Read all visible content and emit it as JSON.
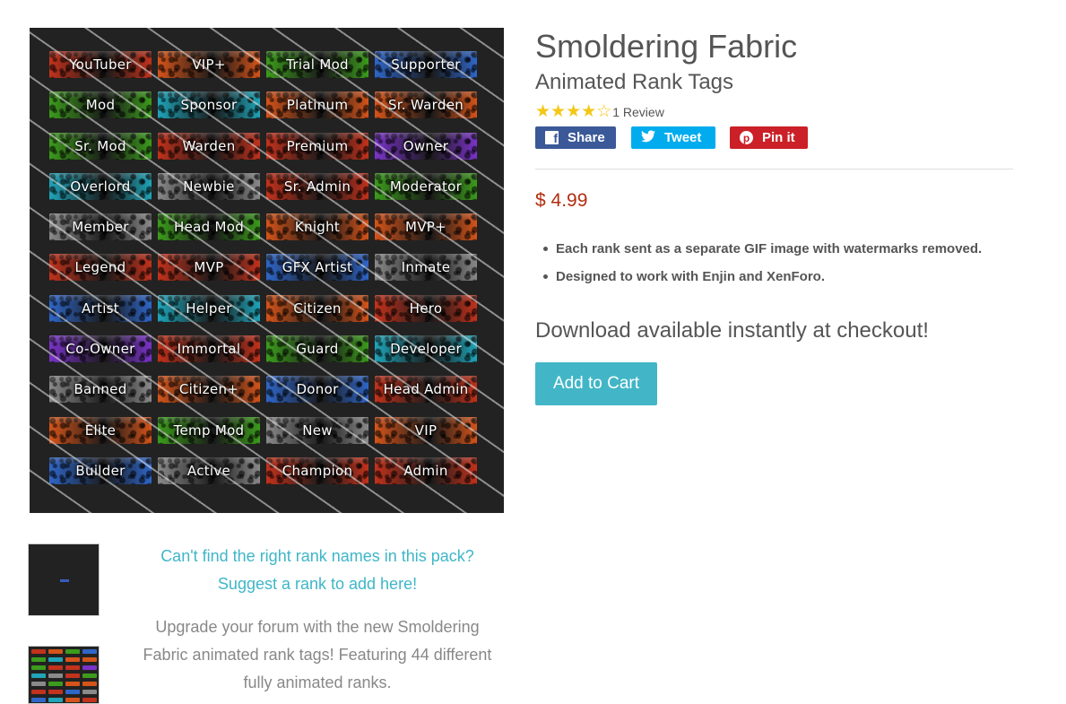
{
  "product": {
    "title": "Smoldering Fabric",
    "subtitle": "Animated Rank Tags",
    "rating": 4,
    "rating_max": 5,
    "review_count": "1 Review",
    "price": "$ 4.99",
    "features": [
      "Each rank sent as a separate GIF image with watermarks removed.",
      "Designed to work with Enjin and XenForo."
    ],
    "download_note": "Download available instantly at checkout!",
    "add_to_cart_label": "Add to Cart"
  },
  "social": {
    "share_label": "Share",
    "tweet_label": "Tweet",
    "pin_label": "Pin it",
    "share_icon": "facebook-icon",
    "tweet_icon": "twitter-icon",
    "pin_icon": "pinterest-icon",
    "share_color": "#3b5998",
    "tweet_color": "#00aced",
    "pin_color": "#cb2027"
  },
  "colors": {
    "accent": "#42b6c7",
    "price": "#b32d10",
    "star": "#f3c716"
  },
  "description": {
    "suggest_line1": "Can't find the right rank names in this pack?",
    "suggest_line2": "Suggest a rank to add here!",
    "body": "Upgrade your forum with the new Smoldering Fabric animated rank tags! Featuring 44 different fully animated ranks."
  },
  "rank_tags": [
    {
      "label": "YouTuber",
      "color": "#c2321c"
    },
    {
      "label": "VIP+",
      "color": "#d4541a"
    },
    {
      "label": "Trial Mod",
      "color": "#3c9b1c"
    },
    {
      "label": "Supporter",
      "color": "#2f66c8"
    },
    {
      "label": "Mod",
      "color": "#3c9b1c"
    },
    {
      "label": "Sponsor",
      "color": "#1fa4b8"
    },
    {
      "label": "Platinum",
      "color": "#d4541a"
    },
    {
      "label": "Sr. Warden",
      "color": "#d4541a"
    },
    {
      "label": "Sr. Mod",
      "color": "#3c9b1c"
    },
    {
      "label": "Warden",
      "color": "#c2321c"
    },
    {
      "label": "Premium",
      "color": "#c2321c"
    },
    {
      "label": "Owner",
      "color": "#7a33c9"
    },
    {
      "label": "Overlord",
      "color": "#1fa4b8"
    },
    {
      "label": "Newbie",
      "color": "#8a8a8a"
    },
    {
      "label": "Sr. Admin",
      "color": "#c2321c"
    },
    {
      "label": "Moderator",
      "color": "#3c9b1c"
    },
    {
      "label": "Member",
      "color": "#8a8a8a"
    },
    {
      "label": "Head Mod",
      "color": "#3c9b1c"
    },
    {
      "label": "Knight",
      "color": "#d4541a"
    },
    {
      "label": "MVP+",
      "color": "#d4541a"
    },
    {
      "label": "Legend",
      "color": "#c2321c"
    },
    {
      "label": "MVP",
      "color": "#c2321c"
    },
    {
      "label": "GFX Artist",
      "color": "#2f66c8"
    },
    {
      "label": "Inmate",
      "color": "#8a8a8a"
    },
    {
      "label": "Artist",
      "color": "#2f66c8"
    },
    {
      "label": "Helper",
      "color": "#1fa4b8"
    },
    {
      "label": "Citizen",
      "color": "#d4541a"
    },
    {
      "label": "Hero",
      "color": "#c2321c"
    },
    {
      "label": "Co-Owner",
      "color": "#7a33c9"
    },
    {
      "label": "Immortal",
      "color": "#c2321c"
    },
    {
      "label": "Guard",
      "color": "#3c9b1c"
    },
    {
      "label": "Developer",
      "color": "#1fa4b8"
    },
    {
      "label": "Banned",
      "color": "#8a8a8a"
    },
    {
      "label": "Citizen+",
      "color": "#d4541a"
    },
    {
      "label": "Donor",
      "color": "#2f66c8"
    },
    {
      "label": "Head Admin",
      "color": "#c2321c"
    },
    {
      "label": "Elite",
      "color": "#d4541a"
    },
    {
      "label": "Temp Mod",
      "color": "#3c9b1c"
    },
    {
      "label": "New",
      "color": "#8a8a8a"
    },
    {
      "label": "VIP",
      "color": "#d4541a"
    },
    {
      "label": "Builder",
      "color": "#2f66c8"
    },
    {
      "label": "Active",
      "color": "#8a8a8a"
    },
    {
      "label": "Champion",
      "color": "#c2321c"
    },
    {
      "label": "Admin",
      "color": "#c2321c"
    }
  ]
}
